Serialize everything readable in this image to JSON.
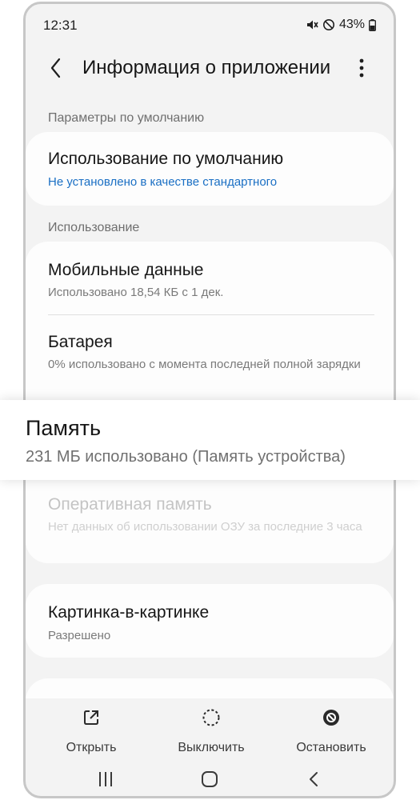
{
  "status_bar": {
    "time": "12:31",
    "battery": "43%",
    "icons": [
      "mute-icon",
      "do-not-disturb-icon",
      "battery-icon"
    ]
  },
  "header": {
    "title": "Информация о приложении",
    "back_icon": "chevron-left-icon",
    "more_icon": "more-vertical-icon"
  },
  "sections": {
    "defaults": {
      "label": "Параметры по умолчанию",
      "item": {
        "title": "Использование по умолчанию",
        "subtitle": "Не установлено в качестве стандартного"
      }
    },
    "usage": {
      "label": "Использование",
      "mobile_data": {
        "title": "Мобильные данные",
        "subtitle": "Использовано 18,54 КБ с 1 дек."
      },
      "battery": {
        "title": "Батарея",
        "subtitle": "0% использовано с момента последней полной зарядки"
      },
      "storage": {
        "title": "Память",
        "subtitle": "231 МБ использовано (Память устройства)"
      },
      "ram": {
        "title": "Оперативная память",
        "subtitle": "Нет данных об использовании ОЗУ за последние 3 часа"
      }
    },
    "pip": {
      "title": "Картинка-в-картинке",
      "subtitle": "Разрешено"
    }
  },
  "actions": {
    "open": {
      "label": "Открыть",
      "icon": "open-external-icon"
    },
    "disable": {
      "label": "Выключить",
      "icon": "disable-circle-icon"
    },
    "stop": {
      "label": "Остановить",
      "icon": "stop-icon"
    }
  },
  "nav": {
    "icons": [
      "recents-icon",
      "home-icon",
      "back-icon"
    ]
  },
  "colors": {
    "accent": "#1a6fc4",
    "background": "#f3f3f3",
    "card": "#fdfdfd"
  }
}
